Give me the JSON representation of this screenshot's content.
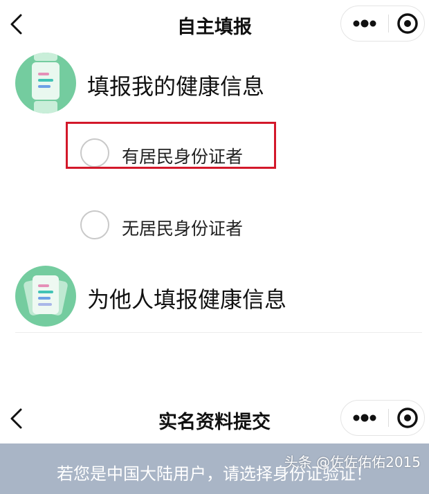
{
  "screen1": {
    "title": "自主填报",
    "options": [
      {
        "label": "填报我的健康信息",
        "icon": "document-icon"
      },
      {
        "label": "为他人填报健康信息",
        "icon": "documents-stack-icon"
      }
    ],
    "id_choices": [
      "有居民身份证者",
      "无居民身份证者"
    ],
    "highlighted_choice_index": 0
  },
  "screen2": {
    "title": "实名资料提交",
    "notice": "若您是中国大陆用户，请选择身份证验证！"
  },
  "watermark": "头条 @佐佐佑佑2015",
  "colors": {
    "icon_green": "#74cc9f",
    "highlight_red": "#d3182a",
    "banner_bg": "#a9b5c6"
  }
}
